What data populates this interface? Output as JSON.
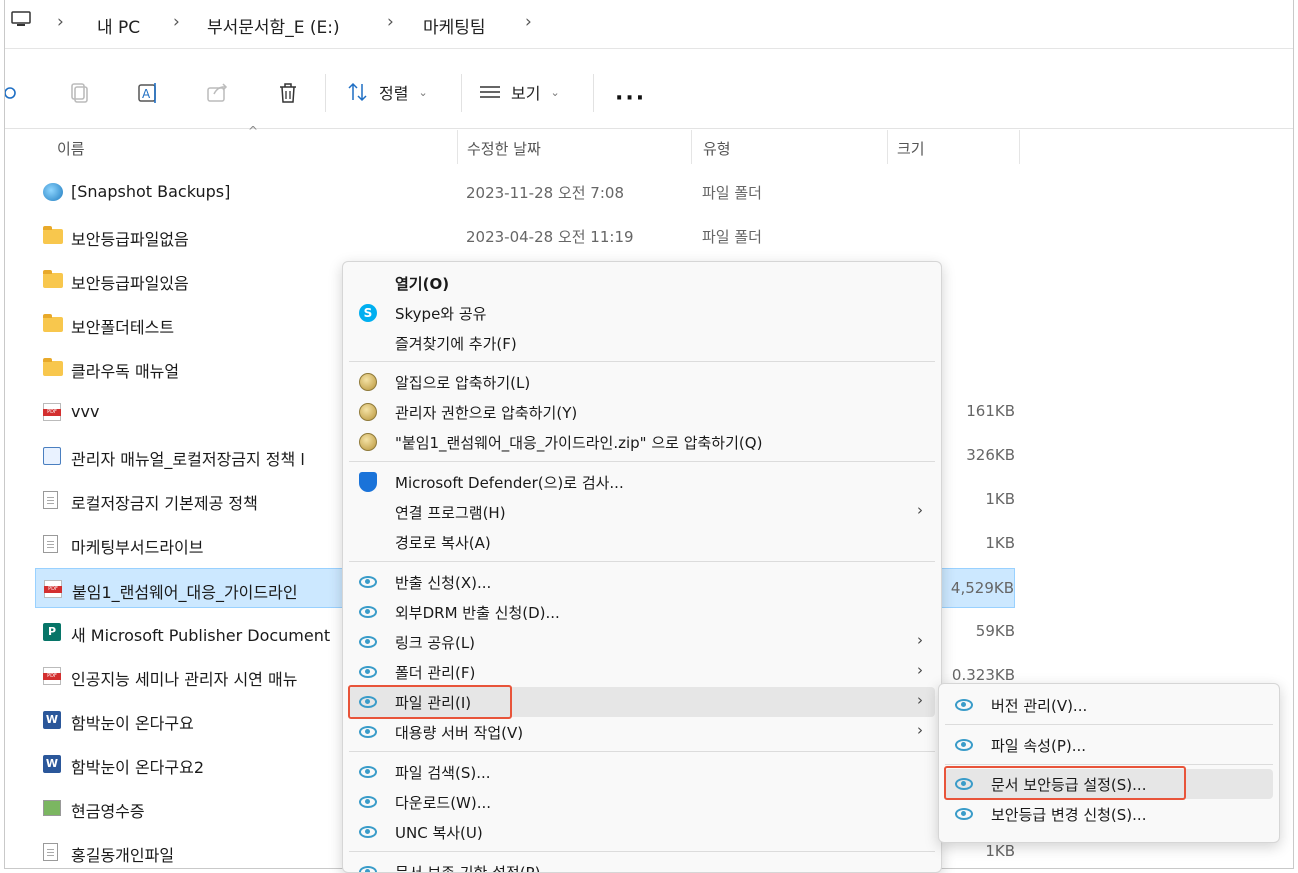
{
  "breadcrumb": {
    "items": [
      "내 PC",
      "부서문서함_E (E:)",
      "마케팅팀"
    ]
  },
  "toolbar": {
    "sort_label": "정렬",
    "view_label": "보기",
    "more_label": "···"
  },
  "columns": {
    "name": "이름",
    "date": "수정한 날짜",
    "type": "유형",
    "size": "크기"
  },
  "files": [
    {
      "name": "[Snapshot Backups]",
      "date": "2023-11-28 오전 7:08",
      "type": "파일 폴더",
      "size": "",
      "icon": "snapshot-icon"
    },
    {
      "name": "보안등급파일없음",
      "date": "2023-04-28 오전 11:19",
      "type": "파일 폴더",
      "size": "",
      "icon": "folder-icon"
    },
    {
      "name": "보안등급파일있음",
      "date": "",
      "type": "",
      "size": "",
      "icon": "folder-icon"
    },
    {
      "name": "보안폴더테스트",
      "date": "",
      "type": "",
      "size": "",
      "icon": "folder-icon"
    },
    {
      "name": "클라우독 매뉴얼",
      "date": "",
      "type": "",
      "size": "",
      "icon": "folder-icon"
    },
    {
      "name": "vvv",
      "date": "",
      "type": "",
      "size": "161KB",
      "icon": "pdf-icon"
    },
    {
      "name": "관리자 매뉴얼_로컬저장금지 정책 l",
      "date": "",
      "type": "",
      "size": "326KB",
      "icon": "secure-doc-icon"
    },
    {
      "name": "로컬저장금지 기본제공 정책",
      "date": "",
      "type": "",
      "size": "1KB",
      "icon": "document-icon"
    },
    {
      "name": "마케팅부서드라이브",
      "date": "",
      "type": "",
      "size": "1KB",
      "icon": "document-icon"
    },
    {
      "name": "붙임1_랜섬웨어_대응_가이드라인",
      "date": "",
      "type": "",
      "size": "4,529KB",
      "icon": "pdf-icon"
    },
    {
      "name": "새 Microsoft Publisher Document",
      "date": "",
      "type": "",
      "size": "59KB",
      "icon": "publisher-icon"
    },
    {
      "name": "인공지능 세미나 관리자  시연 매뉴",
      "date": "",
      "type": "",
      "size": "0.323KB",
      "icon": "pdf-icon"
    },
    {
      "name": "함박눈이 온다구요",
      "date": "",
      "type": "",
      "size": "",
      "icon": "word-icon"
    },
    {
      "name": "함박눈이 온다구요2",
      "date": "",
      "type": "",
      "size": "",
      "icon": "word-icon"
    },
    {
      "name": "현금영수증",
      "date": "",
      "type": "",
      "size": "",
      "icon": "image-icon"
    },
    {
      "name": "홍길동개인파일",
      "date": "",
      "type": "",
      "size": "1KB",
      "icon": "document-icon"
    }
  ],
  "context_menu": {
    "open": "열기(O)",
    "skype_share": "Skype와 공유",
    "add_favorites": "즐겨찾기에 추가(F)",
    "alzip_compress": "알집으로 압축하기(L)",
    "admin_compress": "관리자 권한으로 압축하기(Y)",
    "compress_named": "\"붙임1_랜섬웨어_대응_가이드라인.zip\" 으로 압축하기(Q)",
    "defender_scan": "Microsoft Defender(으)로 검사...",
    "open_with": "연결 프로그램(H)",
    "copy_path": "경로로 복사(A)",
    "export_request": "반출 신청(X)...",
    "external_drm": "외부DRM 반출 신청(D)...",
    "link_share": "링크 공유(L)",
    "folder_manage": "폴더 관리(F)",
    "file_manage": "파일 관리(I)",
    "bulk_server": "대용량 서버 작업(V)",
    "file_search": "파일 검색(S)...",
    "download": "다운로드(W)...",
    "unc_copy": "UNC 복사(U)",
    "doc_preserve": "문서 보존 기한 설정(P)"
  },
  "submenu": {
    "version_manage": "버전 관리(V)...",
    "file_props": "파일 속성(P)...",
    "doc_security": "문서 보안등급 설정(S)...",
    "security_change": "보안등급 변경 신청(S)..."
  },
  "colors": {
    "selection": "#cce8ff",
    "highlight_box": "#e8543a",
    "accent_icon": "#3a9cc9"
  }
}
